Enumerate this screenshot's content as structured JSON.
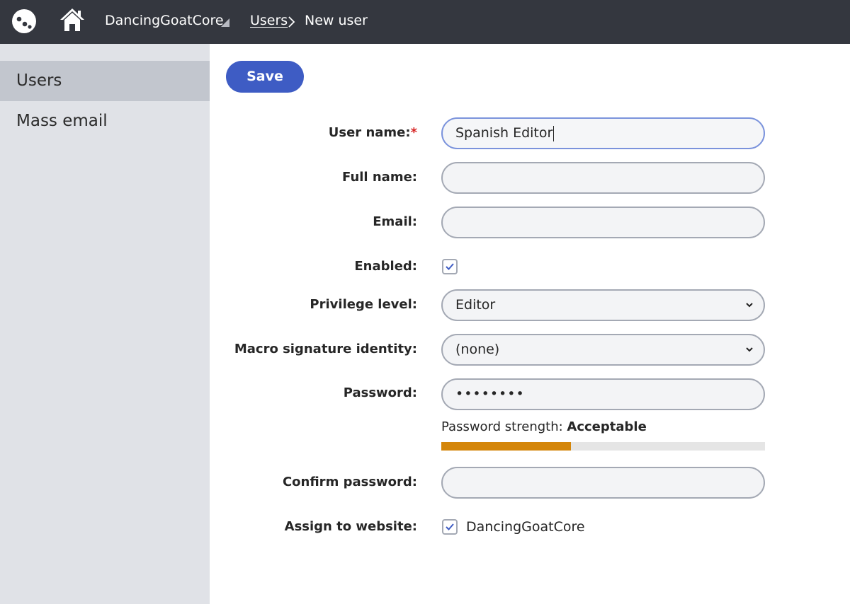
{
  "header": {
    "site_name": "DancingGoatCore",
    "breadcrumb_link": "Users",
    "breadcrumb_current": "New user",
    "icons": {
      "logo": "kentico-logo-icon",
      "home": "home-icon",
      "site_menu": "caret-down-icon",
      "separator": "chevron-right-icon"
    }
  },
  "sidebar": {
    "items": [
      {
        "label": "Users",
        "active": true
      },
      {
        "label": "Mass email",
        "active": false
      }
    ]
  },
  "toolbar": {
    "save_label": "Save"
  },
  "form": {
    "username": {
      "label": "User name:",
      "required_mark": "*",
      "value": "Spanish Editor"
    },
    "fullname": {
      "label": "Full name:",
      "value": ""
    },
    "email": {
      "label": "Email:",
      "value": ""
    },
    "enabled": {
      "label": "Enabled:",
      "checked": true
    },
    "privilege": {
      "label": "Privilege level:",
      "value": "Editor"
    },
    "macro": {
      "label": "Macro signature identity:",
      "value": "(none)"
    },
    "password": {
      "label": "Password:",
      "value": "••••••••"
    },
    "strength": {
      "prefix": "Password strength: ",
      "value": "Acceptable",
      "level_percent": 40,
      "color": "#d4860a"
    },
    "confirm": {
      "label": "Confirm password:",
      "value": ""
    },
    "assign": {
      "label": "Assign to website:",
      "site_label": "DancingGoatCore",
      "checked": true
    }
  },
  "colors": {
    "topbar": "#34373f",
    "sidebar": "#e0e2e7",
    "sidebar_active": "#c2c6ce",
    "accent": "#3e5cc4"
  }
}
